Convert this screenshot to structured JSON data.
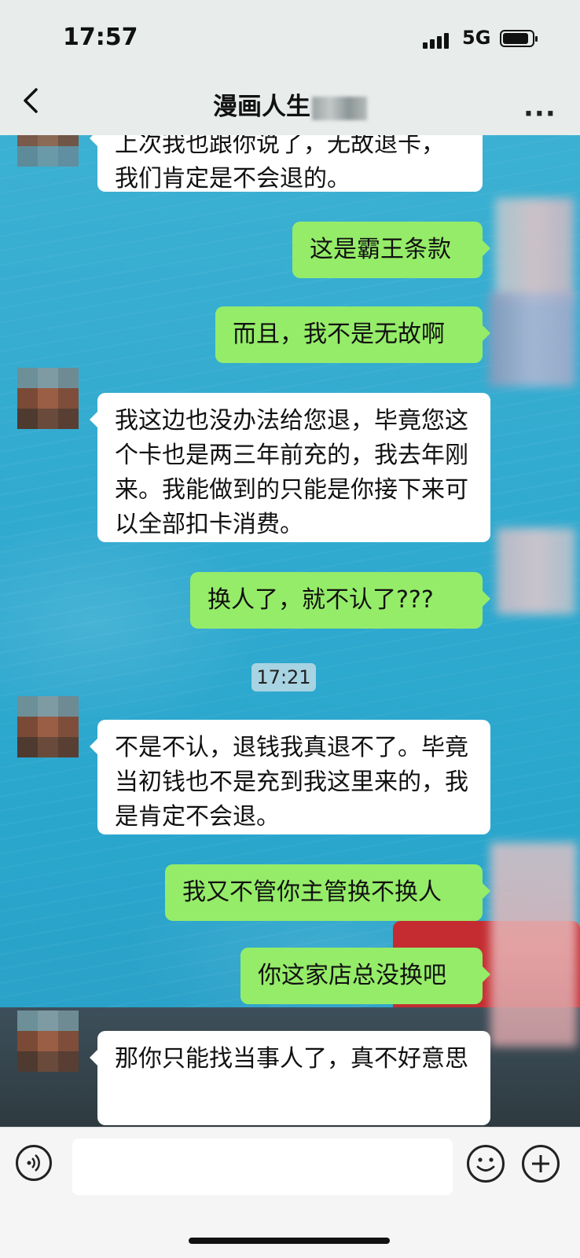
{
  "status_bar": {
    "time": "17:57",
    "network": "5G",
    "battery_level": 0.9
  },
  "nav": {
    "title": "漫画人生",
    "back_icon": "chevron-left-icon",
    "more_label": "···"
  },
  "messages": [
    {
      "side": "left",
      "text": "上次我也跟你说了，无故退卡，我们肯定是不会退的。"
    },
    {
      "side": "right",
      "text": "这是霸王条款"
    },
    {
      "side": "right",
      "text": "而且，我不是无故啊"
    },
    {
      "side": "left",
      "text": "我这边也没办法给您退，毕竟您这个卡也是两三年前充的，我去年刚来。我能做到的只能是你接下来可以全部扣卡消费。"
    },
    {
      "side": "right",
      "text": "换人了，就不认了???"
    },
    {
      "side": "left",
      "text": "不是不认，退钱我真退不了。毕竟当初钱也不是充到我这里来的，我是肯定不会退。"
    },
    {
      "side": "right",
      "text": "我又不管你主管换不换人"
    },
    {
      "side": "right",
      "text": "你这家店总没换吧"
    },
    {
      "side": "left",
      "text": "那你只能找当事人了，真不好意思"
    }
  ],
  "timestamp": "17:21",
  "input_bar": {
    "placeholder": "",
    "voice_icon": "voice-icon",
    "emoji_icon": "emoji-icon",
    "plus_icon": "plus-icon"
  },
  "colors": {
    "bubble_self": "#95ec69",
    "bubble_other": "#ffffff",
    "chat_bg": "#2fa9cf"
  }
}
